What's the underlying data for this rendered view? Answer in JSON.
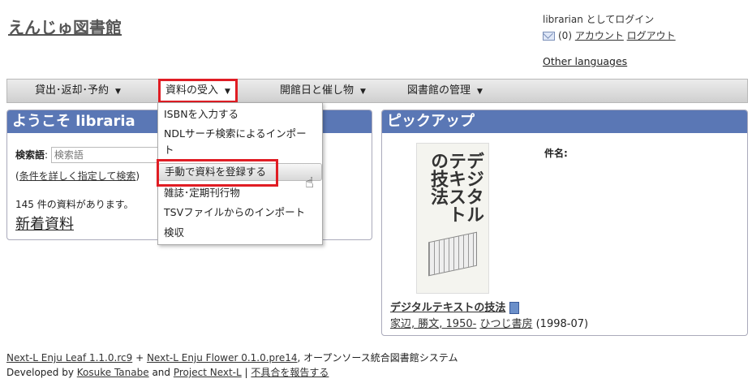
{
  "site": {
    "title": "えんじゅ図書館"
  },
  "login": {
    "status": "librarian としてログイン",
    "mail_count": "(0)",
    "account": "アカウント",
    "logout": "ログアウト",
    "other_languages": "Other languages"
  },
  "nav": {
    "items": [
      {
        "label": "貸出･返却･予約"
      },
      {
        "label": "資料の受入"
      },
      {
        "label": "開館日と催し物"
      },
      {
        "label": "図書館の管理"
      }
    ]
  },
  "dropdown": {
    "items": [
      {
        "label": "ISBNを入力する"
      },
      {
        "label": "NDLサーチ検索によるインポー"
      },
      {
        "label": "ト"
      },
      {
        "label": "手動で資料を登録する"
      },
      {
        "label": "雑誌･定期刊行物"
      },
      {
        "label": "TSVファイルからのインポート"
      },
      {
        "label": "検収"
      }
    ]
  },
  "welcome": {
    "heading": "ようこそ libraria",
    "search_label": "検索語",
    "search_placeholder": "検索語",
    "advanced_search_prefix": "(",
    "advanced_search": "条件を詳しく指定して検索",
    "advanced_search_suffix": ")",
    "count_text": "145 件の資料があります。",
    "new_items": "新着資料"
  },
  "pickup": {
    "heading": "ピックアップ",
    "cover_text": "デジタルテキストの技法",
    "subject_label": "件名:",
    "book_title": "デジタルテキストの技法",
    "author": "家辺, 勝文, 1950-",
    "publisher": "ひつじ書房",
    "date": "(1998-07)"
  },
  "footer": {
    "leaf": "Next-L Enju Leaf 1.1.0.rc9",
    "plus": "+",
    "flower": "Next-L Enju Flower 0.1.0.pre14",
    "desc": ", オープンソース統合図書館システム",
    "developed_by": "Developed by",
    "author": "Kosuke Tanabe",
    "and": "and",
    "project": "Project Next-L",
    "sep": "|",
    "report": "不具合を報告する"
  },
  "colors": {
    "panel_header": "#5a77b5",
    "highlight": "#e01d24"
  }
}
